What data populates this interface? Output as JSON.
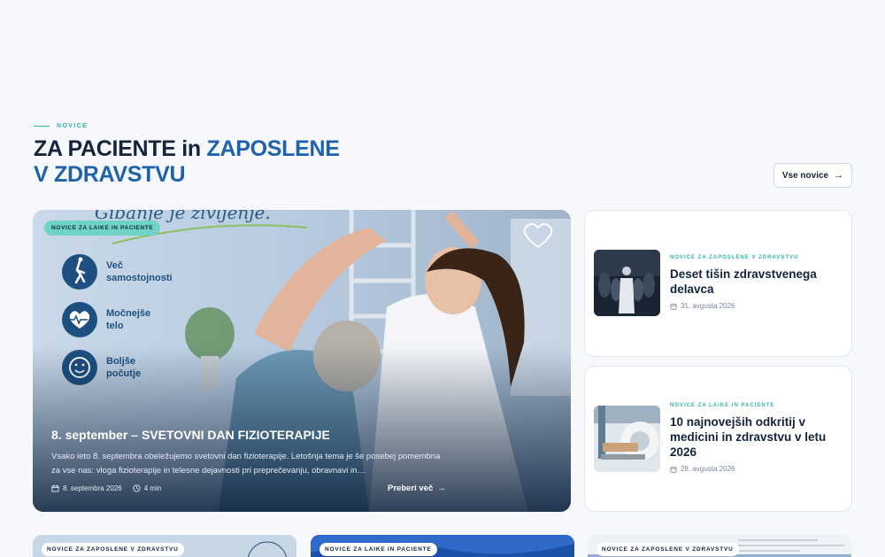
{
  "section": {
    "eyebrow": "NOVICE",
    "title_dark": "ZA PACIENTE in",
    "title_blue_1": "ZAPOSLENE",
    "title_blue_2": "V ZDRAVSTVU",
    "all_button": "Vse novice"
  },
  "hero": {
    "category": "NOVICE ZA LAIKE IN PACIENTE",
    "title": "8. september – SVETOVNI DAN FIZIOTERAPIJE",
    "excerpt": "Vsako leto 8. septembra obeležujemo svetovni dan fizioterapije. Letošnja tema je še posebej pomembna za vse nas: vloga fizioterapije in telesne dejavnosti pri preprečevanju, obravnavi in…",
    "date": "8. septembra 2026",
    "read_time": "4 min",
    "read_more": "Preberi več",
    "image_text": {
      "slogan": "Gibanje je življenje.",
      "benefit_1_line1": "Več",
      "benefit_1_line2": "samostojnosti",
      "benefit_2_line1": "Močnejše",
      "benefit_2_line2": "telo",
      "benefit_3_line1": "Boljše",
      "benefit_3_line2": "počutje"
    }
  },
  "side_articles": [
    {
      "category": "NOVICE ZA ZAPOSLENE V ZDRAVSTVU",
      "title": "Deset tišin zdravstvenega delavca",
      "date": "31. avgusta 2026"
    },
    {
      "category": "NOVICE ZA LAIKE IN PACIENTE",
      "title": "10 najnovejših odkritij v medicini in zdravstvu v letu 2026",
      "date": "28. avgusta 2026"
    }
  ],
  "bottom_articles": [
    {
      "category": "NOVICE ZA ZAPOSLENE V ZDRAVSTVU"
    },
    {
      "category": "NOVICE ZA LAIKE IN PACIENTE"
    },
    {
      "category": "NOVICE ZA ZAPOSLENE V ZDRAVSTVU"
    }
  ],
  "colors": {
    "accent_teal": "#2fb3a7",
    "brand_blue": "#1d62ab",
    "heading": "#14243b",
    "background": "#f6f8fc"
  },
  "icons": [
    "arrow-right-icon",
    "calendar-icon",
    "clock-icon",
    "walking-person-icon",
    "heart-pulse-icon",
    "smiley-icon",
    "heart-outline-icon"
  ]
}
